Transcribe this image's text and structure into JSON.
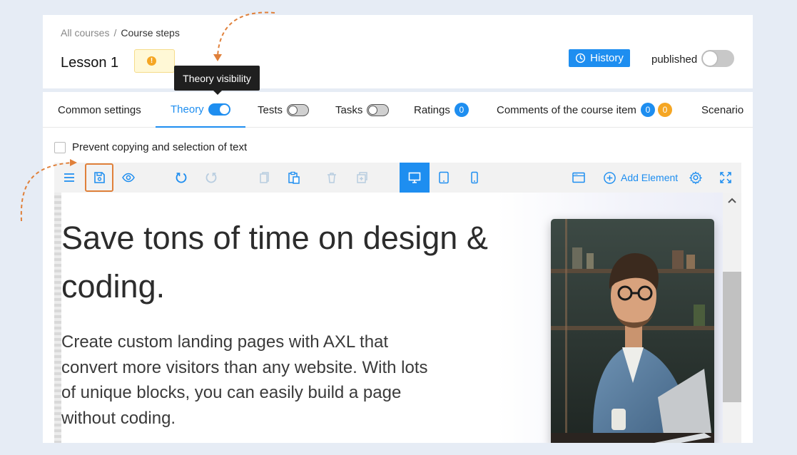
{
  "breadcrumb": {
    "parent": "All courses",
    "separator": "/",
    "current": "Course steps"
  },
  "lesson": {
    "title": "Lesson 1",
    "warning_icon": "!"
  },
  "header": {
    "history_label": "History",
    "published_label": "published",
    "published": false
  },
  "tooltip": {
    "text": "Theory visibility"
  },
  "tabs": [
    {
      "label": "Common settings"
    },
    {
      "label": "Theory",
      "active": true,
      "toggle": true
    },
    {
      "label": "Tests",
      "toggle": false
    },
    {
      "label": "Tasks",
      "toggle": false
    },
    {
      "label": "Ratings",
      "badge": "0"
    },
    {
      "label": "Comments of the course item",
      "badge": "0",
      "badge2": "0"
    },
    {
      "label": "Scenario"
    }
  ],
  "prevent_copy": {
    "label": "Prevent copying and selection of text",
    "checked": false
  },
  "toolbar": {
    "add_element_label": "Add Element",
    "active_device": "desktop"
  },
  "hero": {
    "title": "Save tons of time on design & coding.",
    "description": "Create custom landing pages with AXL that convert more visitors than any website. With lots of unique blocks, you can easily build a page without coding."
  },
  "colors": {
    "accent": "#1e8ef0",
    "warning": "#f5a623",
    "highlight": "#e0803a"
  }
}
